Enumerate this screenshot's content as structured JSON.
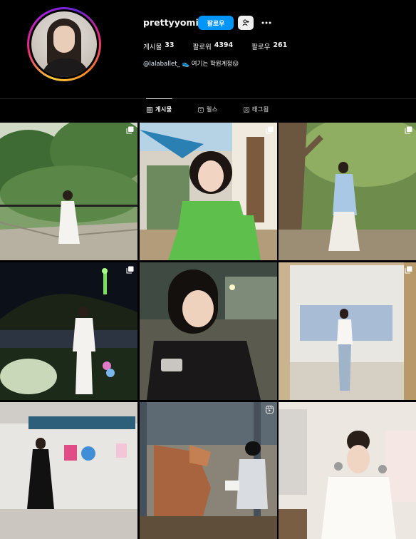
{
  "profile": {
    "username": "prettyyomi",
    "follow_label": "팔로우",
    "suggest_icon": "add-person-icon",
    "more_icon": "more-horizontal-icon",
    "stats": [
      {
        "label": "게시물",
        "value": "33"
      },
      {
        "label": "팔로워",
        "value": "4394"
      },
      {
        "label": "팔로우",
        "value": "261"
      }
    ],
    "bio_link": "@lalaballet_",
    "bio_text": "여기는 학원계정",
    "bio_emoji_1": "👟",
    "bio_emoji_2": "😛"
  },
  "tabs": [
    {
      "label": "게시물",
      "icon": "grid-icon",
      "active": true
    },
    {
      "label": "릴스",
      "icon": "reels-icon",
      "active": false
    },
    {
      "label": "태그됨",
      "icon": "tagged-icon",
      "active": false
    }
  ],
  "posts": [
    {
      "scene": "garden-hammock",
      "badge": "multi-photo-icon"
    },
    {
      "scene": "green-top-cafe",
      "badge": "multi-photo-icon"
    },
    {
      "scene": "forest-blue-cardigan",
      "badge": "multi-photo-icon"
    },
    {
      "scene": "night-city-tower",
      "badge": "multi-photo-icon"
    },
    {
      "scene": "black-dress-phone",
      "badge": "none"
    },
    {
      "scene": "white-room-mirror",
      "badge": "multi-photo-icon"
    },
    {
      "scene": "gallery-black-dress",
      "badge": "none"
    },
    {
      "scene": "horse-stable",
      "badge": "reels-icon"
    },
    {
      "scene": "white-top-spoons",
      "badge": "none"
    }
  ],
  "colors": {
    "background": "#000000",
    "accent": "#0095f6",
    "text": "#f5f5f5",
    "muted": "#a8a8a8",
    "divider": "#262626"
  }
}
